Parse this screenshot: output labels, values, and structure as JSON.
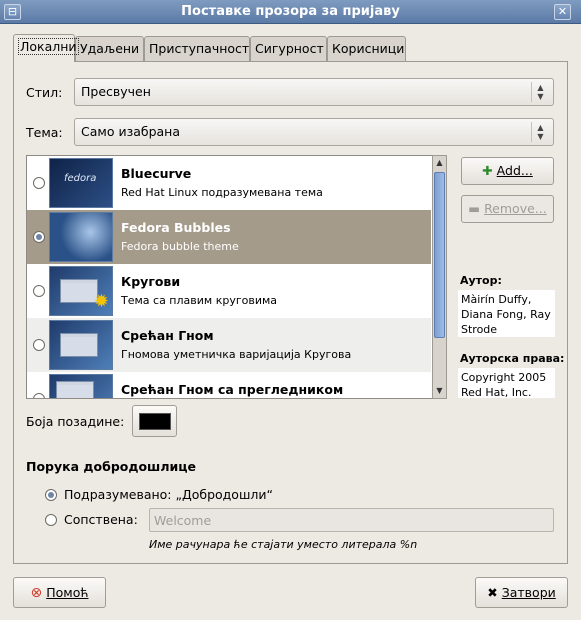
{
  "window": {
    "title": "Поставке прозора за пријаву"
  },
  "tabs": [
    "Локални",
    "Удаљени",
    "Приступачност",
    "Сигурност",
    "Корисници"
  ],
  "style": {
    "label": "Стил:",
    "value": "Пресвучен"
  },
  "theme": {
    "label": "Тема:",
    "value": "Само изабрана"
  },
  "themes": [
    {
      "name": "Bluecurve",
      "desc": "Red Hat Linux подразумевана тема",
      "selected": false
    },
    {
      "name": "Fedora Bubbles",
      "desc": "Fedora bubble theme",
      "selected": true
    },
    {
      "name": "Кругови",
      "desc": "Тема са плавим круговима",
      "selected": false
    },
    {
      "name": "Срећан Гном",
      "desc": "Гномова уметничка варијација Кругова",
      "selected": false
    },
    {
      "name": "Срећан Гном са прегледником",
      "desc": "",
      "selected": false
    }
  ],
  "buttons": {
    "add": "Add...",
    "remove": "Remove...",
    "help": "Помоћ",
    "close": "Затвори"
  },
  "author": {
    "label": "Аутор:",
    "value": "Màirín Duffy, Diana Fong, Ray Strode"
  },
  "copyright": {
    "label": "Ауторска права:",
    "value": "Copyright 2005 Red Hat, Inc."
  },
  "background": {
    "label": "Боја позадине:",
    "color": "#000000"
  },
  "welcome": {
    "heading": "Порука добродошлице",
    "default_label": "Подразумевано: „Добродошли“",
    "custom_label": "Сопствена:",
    "custom_value": "Welcome",
    "hint": "Име рачунара ће стајати уместо литерала %n",
    "default_selected": true
  },
  "colors": {
    "titlebar": "#6b88b2",
    "selected_row": "#a59b8b",
    "scrollbar": "#7d9fd2"
  }
}
